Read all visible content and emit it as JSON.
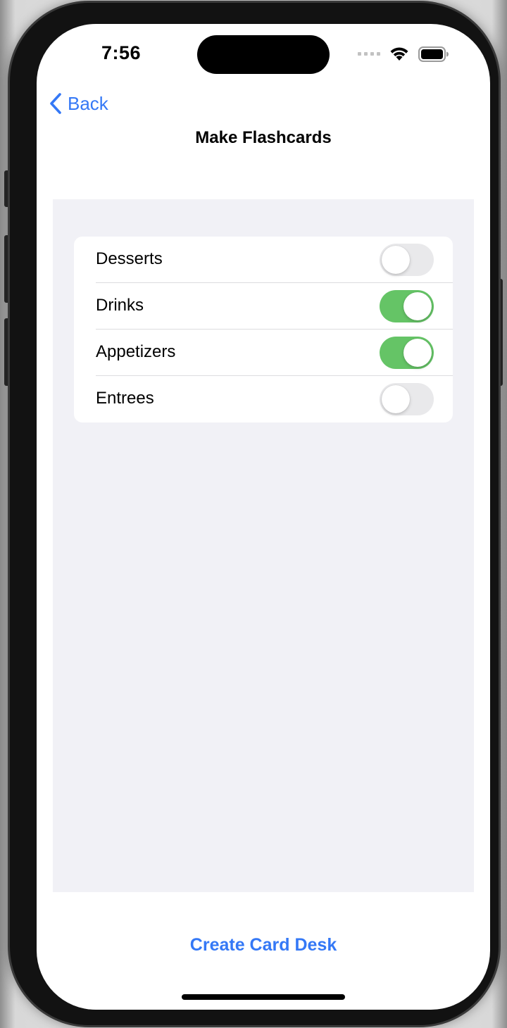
{
  "status_bar": {
    "time": "7:56",
    "icons": [
      "cellular-signal-icon",
      "wifi-icon",
      "battery-icon"
    ]
  },
  "nav": {
    "back_label": "Back",
    "back_icon": "chevron-left-icon",
    "title": "Make Flashcards"
  },
  "categories": [
    {
      "label": "Desserts",
      "enabled": false
    },
    {
      "label": "Drinks",
      "enabled": true
    },
    {
      "label": "Appetizers",
      "enabled": true
    },
    {
      "label": "Entrees",
      "enabled": false
    }
  ],
  "footer": {
    "create_label": "Create Card Desk"
  },
  "colors": {
    "accent": "#3478f6",
    "toggle_on": "#65c466",
    "toggle_off": "#e9e9eb",
    "grouped_background": "#f1f1f6"
  }
}
